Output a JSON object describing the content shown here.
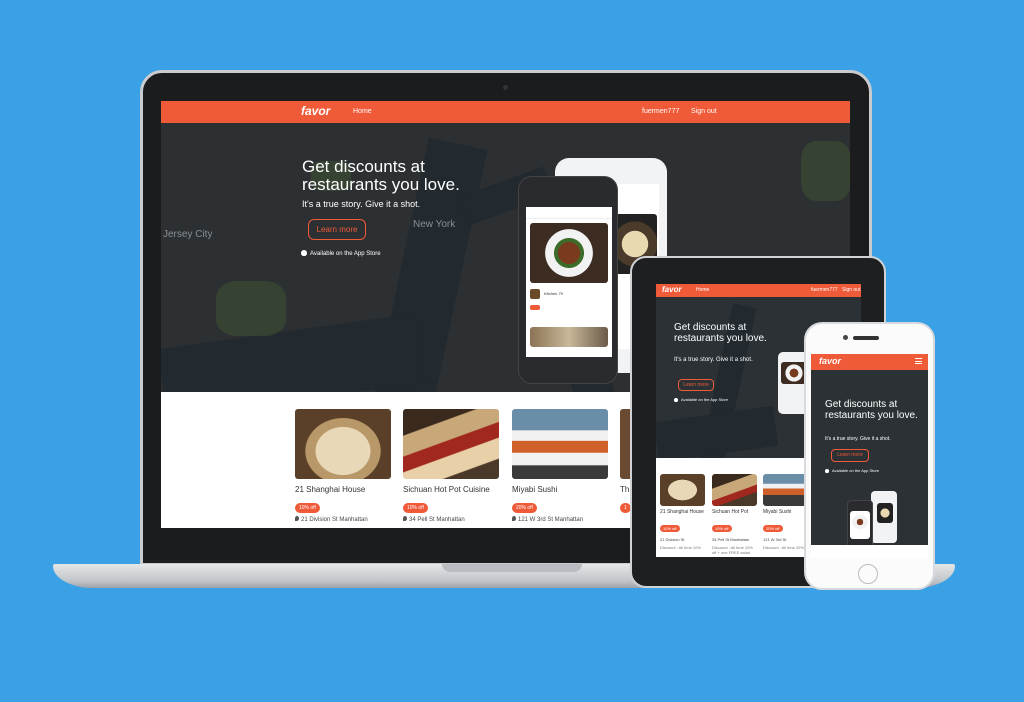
{
  "brand": {
    "logo": "favor",
    "accent": "#ef5a38",
    "background": "#3ba1e6"
  },
  "nav": {
    "home": "Home",
    "user": "fuermen777",
    "sign_out": "Sign out"
  },
  "hero": {
    "title": "Get discounts at restaurants you love.",
    "subtitle": "It's a true story. Give it a shot.",
    "cta": "Learn more",
    "store": "Available on the App Store"
  },
  "map": {
    "label_nj": "Jersey City",
    "label_ny": "New York"
  },
  "app_preview": {
    "item_name": "Kitchen 79"
  },
  "restaurants": [
    {
      "name": "21 Shanghai House",
      "discount": "10% off",
      "address": "21 Division St Manhattan"
    },
    {
      "name": "Sichuan Hot Pot Cuisine",
      "discount": "10% off",
      "address": "34 Pell St Manhattan"
    },
    {
      "name": "Miyabi Sushi",
      "discount": "20% off",
      "address": "121 W 3rd St Manhattan"
    },
    {
      "name": "Th",
      "discount": "1"
    }
  ],
  "tablet": {
    "restaurants": [
      {
        "name": "21 Shanghai House",
        "discount": "10% off",
        "address": "21 Division St",
        "note": "Discount : All time 10%"
      },
      {
        "name": "Sichuan Hot Pot",
        "discount": "10% off",
        "address": "34 Pell St Manhattan",
        "note": "Discount : All time 10% off + one FREE salad"
      },
      {
        "name": "Miyabi Sushi",
        "discount": "20% off",
        "address": "121 W 3rd St",
        "note": "Discount : All time 20%"
      }
    ]
  }
}
